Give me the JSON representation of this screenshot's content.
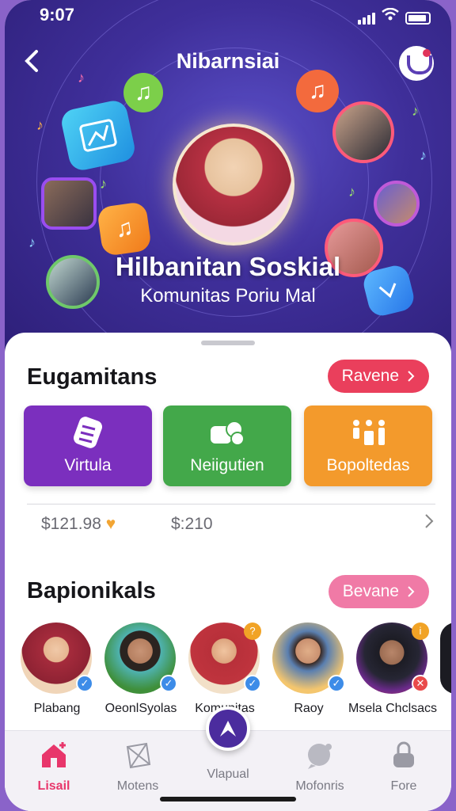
{
  "status_bar": {
    "time": "9:07"
  },
  "header": {
    "title": "Nibarnsiai"
  },
  "hero": {
    "title": "Hilbanitan Soskial",
    "subtitle": "Komunitas Poriu Mal"
  },
  "section1": {
    "title": "Eugamitans",
    "action_label": "Ravene",
    "categories": [
      {
        "label": "Virtula",
        "color": "#7b2fbe"
      },
      {
        "label": "Neiigutien",
        "color": "#43a84a"
      },
      {
        "label": "Bopoltedas",
        "color": "#f39a2c"
      }
    ],
    "prices": [
      "$121.98",
      "$:210"
    ]
  },
  "section2": {
    "title": "Bapionikals",
    "action_label": "Bevane",
    "people": [
      {
        "name": "Plabang"
      },
      {
        "name": "OeonlSyolas"
      },
      {
        "name": "Komunitas"
      },
      {
        "name": "Raoy"
      },
      {
        "name": "Msela Chclsacs"
      }
    ]
  },
  "tabbar": {
    "tabs": [
      {
        "label": "Lisail"
      },
      {
        "label": "Motens"
      },
      {
        "label": "Vlapual"
      },
      {
        "label": "Mofonris"
      },
      {
        "label": "Fore"
      }
    ]
  },
  "colors": {
    "accent_pink": "#e8366b",
    "hero_purple": "#3f2f9a",
    "check_blue": "#3d8ce8"
  }
}
